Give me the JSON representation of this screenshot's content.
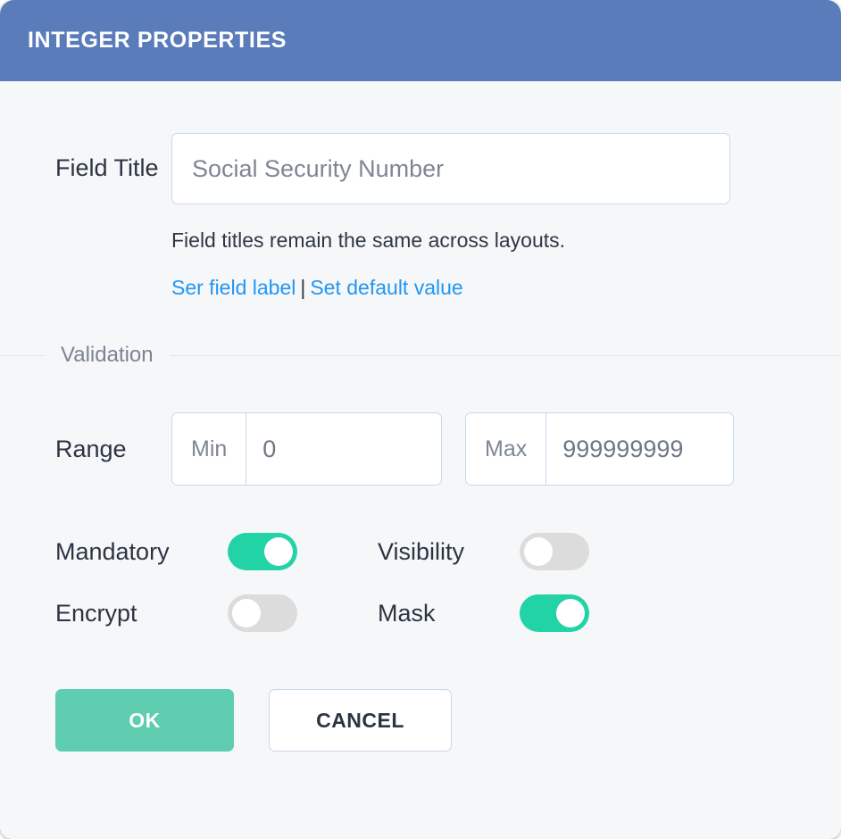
{
  "dialog": {
    "title": "INTEGER PROPERTIES"
  },
  "field_title": {
    "label": "Field Title",
    "value": "",
    "placeholder": "Social Security Number",
    "help_text": "Field titles remain the same across layouts.",
    "links": [
      {
        "label": "Ser field label"
      },
      {
        "label": "Set default value"
      }
    ],
    "link_separator": "|"
  },
  "validation": {
    "legend": "Validation",
    "range": {
      "label": "Range",
      "min": {
        "addon": "Min",
        "value": "0",
        "placeholder": ""
      },
      "max": {
        "addon": "Max",
        "value": "999999999",
        "placeholder": ""
      }
    },
    "toggles": [
      {
        "label": "Mandatory",
        "state": "on"
      },
      {
        "label": "Visibility",
        "state": "off"
      },
      {
        "label": "Encrypt",
        "state": "off"
      },
      {
        "label": "Mask",
        "state": "on"
      }
    ]
  },
  "actions": {
    "ok_label": "OK",
    "cancel_label": "CANCEL"
  },
  "colors": {
    "header_blue": "#5a7cbb",
    "toggle_on_green": "#22d3a5",
    "toggle_off_gray": "#dcdcdc",
    "ok_button_green": "#5fcdb0",
    "link_blue": "#2196f3",
    "body_background": "#f6f7f8",
    "input_border": "#c9d9e9"
  }
}
